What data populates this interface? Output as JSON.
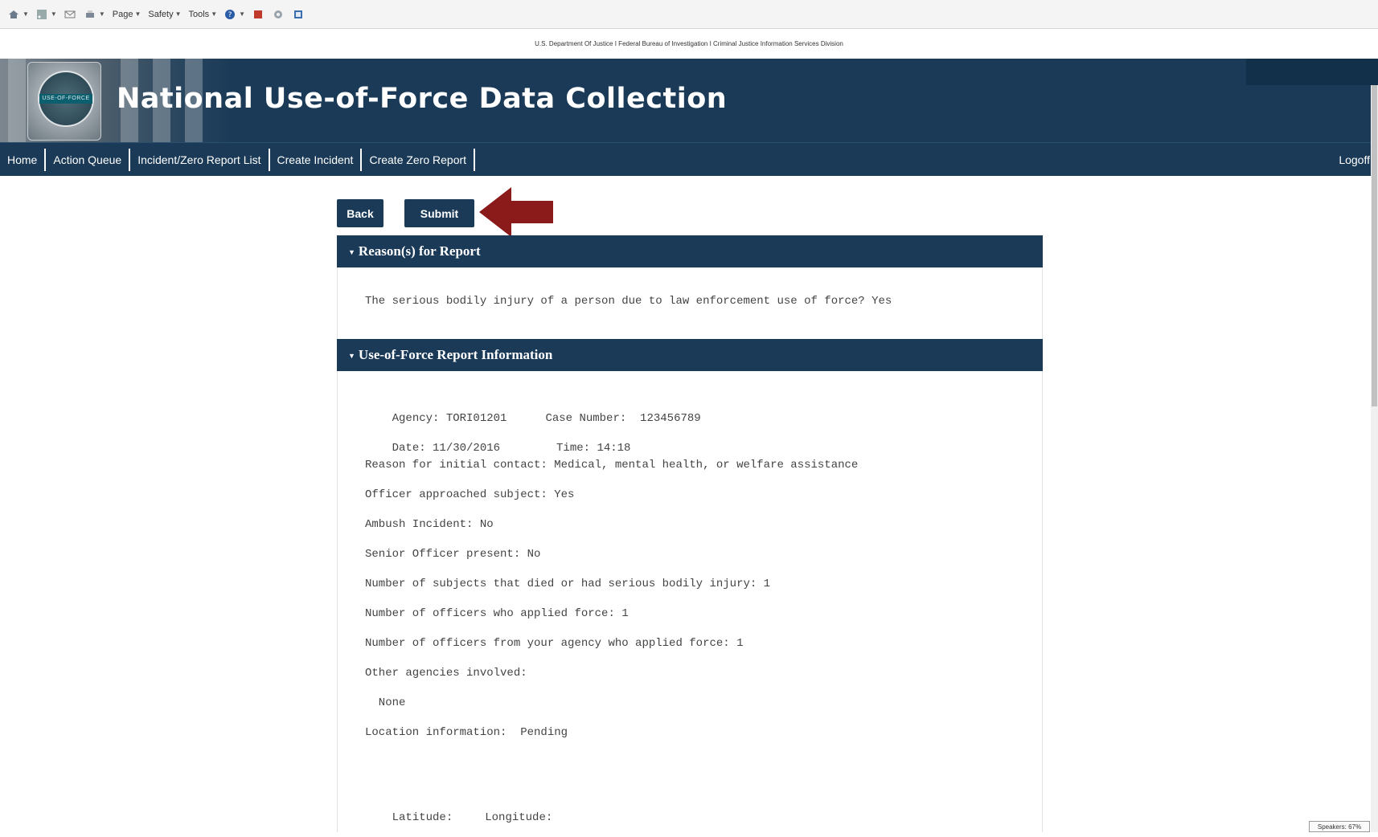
{
  "toolbar": {
    "items": [
      {
        "icon": "home-icon"
      },
      {
        "icon": "feeds-icon"
      },
      {
        "icon": "mail-icon"
      },
      {
        "icon": "print-icon"
      },
      {
        "label": "Page"
      },
      {
        "label": "Safety"
      },
      {
        "label": "Tools"
      },
      {
        "icon": "help-icon"
      },
      {
        "icon": "addon-icon"
      },
      {
        "icon": "settings-icon"
      },
      {
        "icon": "research-icon"
      }
    ],
    "page_label": "Page",
    "safety_label": "Safety",
    "tools_label": "Tools"
  },
  "doj_banner": "U.S. Department Of Justice I Federal Bureau of Investigation I Criminal Justice Information Services Division",
  "header": {
    "title": "National Use-of-Force Data Collection",
    "logo_text": "USE-OF-FORCE"
  },
  "nav": {
    "items": [
      "Home",
      "Action Queue",
      "Incident/Zero Report List",
      "Create Incident",
      "Create Zero Report"
    ],
    "logoff": "Logoff"
  },
  "actions": {
    "back": "Back",
    "submit": "Submit"
  },
  "sections": {
    "reasons": {
      "title": "Reason(s) for Report",
      "text": "The serious bodily injury of a person due to law enforcement use of force? Yes"
    },
    "info": {
      "title": "Use-of-Force Report Information",
      "agency": "Agency: TORI01201",
      "case_number": "Case Number:  123456789",
      "date": "Date: 11/30/2016",
      "time": "Time: 14:18",
      "lines": [
        "Reason for initial contact: Medical, mental health, or welfare assistance",
        "Officer approached subject: Yes",
        "Ambush Incident: No",
        "Senior Officer present: No",
        "Number of subjects that died or had serious bodily injury: 1",
        "Number of officers who applied force: 1",
        "Number of officers from your agency who applied force: 1",
        "Other agencies involved:",
        "  None",
        "Location information:  Pending"
      ],
      "latitude": "Latitude:",
      "longitude": "Longitude:"
    }
  },
  "status": {
    "speakers": "Speakers: 67%"
  },
  "colors": {
    "brand_navy": "#1a3a57",
    "arrow_red": "#8b1a1a"
  }
}
